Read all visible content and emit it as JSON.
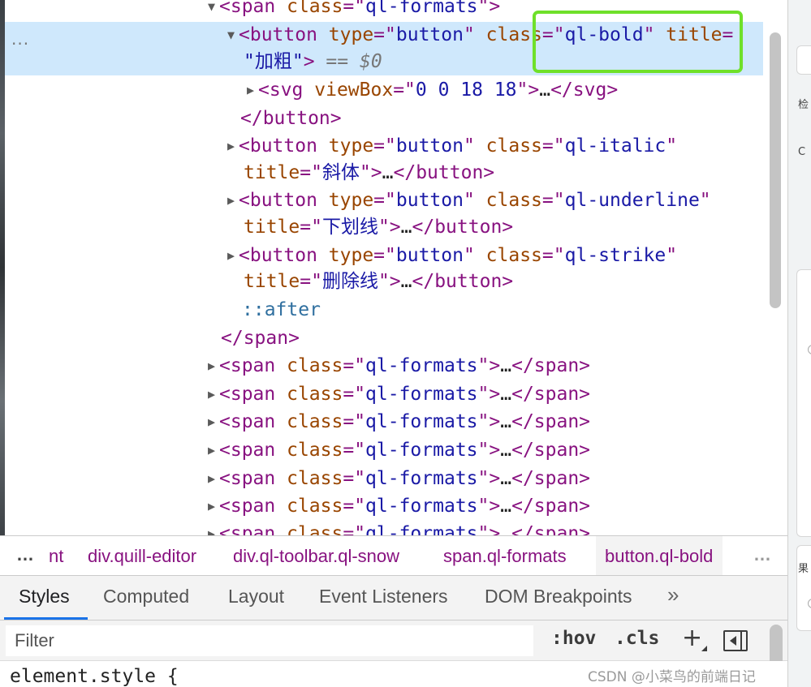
{
  "elements_tree": {
    "top_span": {
      "open": "<span ",
      "attr": "class",
      "eq": "=\"",
      "value": "ql-formats",
      "close": "\">"
    },
    "bold_button": {
      "open": "<button ",
      "attr1": "type",
      "val1": "button",
      "attr2": "class",
      "val2": "ql-bold",
      "attr3": "title",
      "eq": "=",
      "val3": "加粗",
      "selected_marker": "== ",
      "dollar_var": "$0",
      "more_menu": "..."
    },
    "svg": {
      "open": "<svg ",
      "attr": "viewBox",
      "value": "0 0 18 18",
      "ellipsis": "…",
      "close_tag": "</svg>"
    },
    "close_button": "</button>",
    "italic_button": {
      "open": "<button ",
      "attr1": "type",
      "val1": "button",
      "attr2": "class",
      "val2": "ql-italic",
      "attr3": "title",
      "val3": "斜体",
      "ellipsis": "…",
      "close_tag": "</button>"
    },
    "underline_button": {
      "open": "<button ",
      "attr1": "type",
      "val1": "button",
      "attr2": "class",
      "val2": "ql-underline",
      "attr3": "title",
      "val3": "下划线",
      "ellipsis": "…",
      "close_tag": "</button>"
    },
    "strike_button": {
      "open": "<button ",
      "attr1": "type",
      "val1": "button",
      "attr2": "class",
      "val2": "ql-strike",
      "attr3": "title",
      "val3": "删除线",
      "ellipsis": "…",
      "close_tag": "</button>"
    },
    "after_pseudo": "::after",
    "close_span": "</span>",
    "collapsed_span": {
      "open": "<span ",
      "attr": "class",
      "value": "ql-formats",
      "ellipsis": "…",
      "close_tag": "</span>"
    }
  },
  "breadcrumb": {
    "leading_dots": "…",
    "items": [
      "nt",
      "div.quill-editor",
      "div.ql-toolbar.ql-snow",
      "span.ql-formats",
      "button.ql-bold"
    ],
    "trailing_dots": "…"
  },
  "tabs": {
    "items": [
      "Styles",
      "Computed",
      "Layout",
      "Event Listeners",
      "DOM Breakpoints"
    ],
    "more": "»"
  },
  "filter": {
    "placeholder": "Filter",
    "hov": ":hov",
    "cls": ".cls",
    "plus": "+"
  },
  "styles": {
    "first_rule": "element.style {"
  },
  "watermark": "CSDN @小菜鸟的前端日记",
  "right_panel": {
    "text1": "检",
    "text2": "C",
    "text3": "果"
  },
  "colors": {
    "selection": "#cfe8fc",
    "highlight_box": "#6fe02a",
    "tag": "#881280",
    "attr": "#994500",
    "value": "#1a1aa6",
    "accent": "#1a73e8"
  }
}
